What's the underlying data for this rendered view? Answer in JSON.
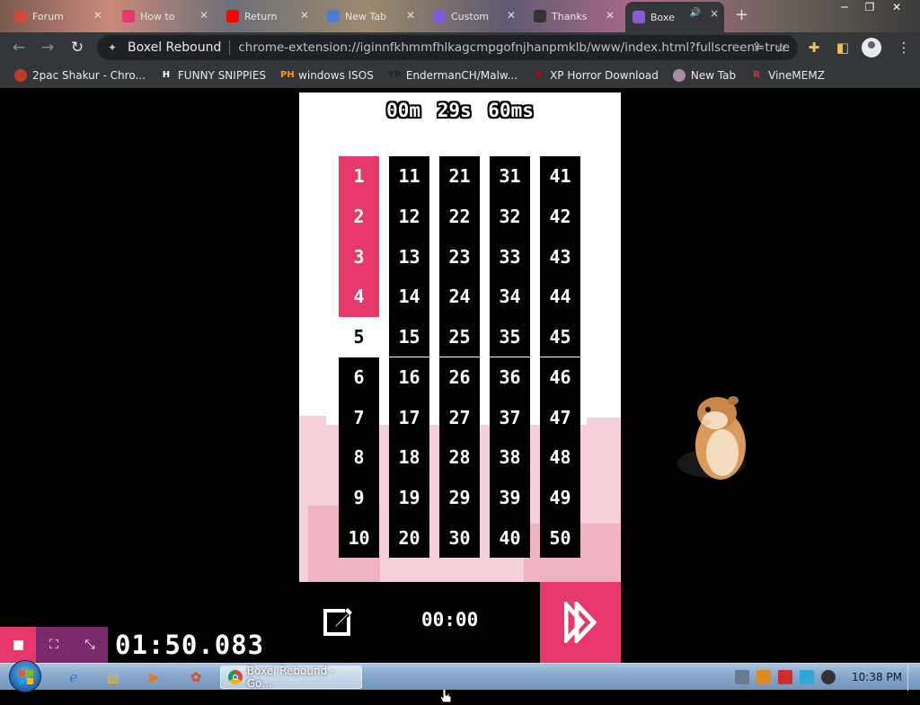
{
  "tabs": [
    {
      "title": "Forum",
      "color": "#d04a3a"
    },
    {
      "title": "How to",
      "color": "#e6386a"
    },
    {
      "title": "Return",
      "color": "#ff0000"
    },
    {
      "title": "New Tab",
      "color": "#4f7bd6"
    },
    {
      "title": "Custom",
      "color": "#7b5bd6"
    },
    {
      "title": "Thanks",
      "color": "#333333"
    },
    {
      "title": "Boxe",
      "color": "#8a5bd6",
      "active": true
    }
  ],
  "toolbar": {
    "site_name": "Boxel Rebound",
    "url": "chrome-extension://iginnfkhmmfhlkagcmpgofnjhanpmklb/www/index.html?fullscreen=true"
  },
  "bookmarks": [
    {
      "label": "2pac Shakur - Chro...",
      "icon_text": "",
      "icon_color": "#c0392b"
    },
    {
      "label": "FUNNY SNIPPIES",
      "icon_text": "H",
      "icon_color": "#ffffff"
    },
    {
      "label": "windows ISOS",
      "icon_text": "PH",
      "icon_color": "#ff9900"
    },
    {
      "label": "EndermanCH/Malw...",
      "icon_text": "YP",
      "icon_color": "#222222"
    },
    {
      "label": "XP Horror Download",
      "icon_text": "X",
      "icon_color": "#cc0000"
    },
    {
      "label": "New Tab",
      "icon_text": "",
      "icon_color": "#aa88aa"
    },
    {
      "label": "VineMEMZ",
      "icon_text": "R",
      "icon_color": "#d62d3a"
    }
  ],
  "game": {
    "timer": {
      "minutes": "00m",
      "seconds": "29s",
      "ms": "60ms"
    },
    "levels_completed": 4,
    "current_level": 5,
    "columns": [
      [
        "1",
        "2",
        "3",
        "4",
        "5",
        "6",
        "7",
        "8",
        "9",
        "10"
      ],
      [
        "11",
        "12",
        "13",
        "14",
        "15",
        "16",
        "17",
        "18",
        "19",
        "20"
      ],
      [
        "21",
        "22",
        "23",
        "24",
        "25",
        "26",
        "27",
        "28",
        "29",
        "30"
      ],
      [
        "31",
        "32",
        "33",
        "34",
        "35",
        "36",
        "37",
        "38",
        "39",
        "40"
      ],
      [
        "41",
        "42",
        "43",
        "44",
        "45",
        "46",
        "47",
        "48",
        "49",
        "50"
      ]
    ],
    "bottom_time": "00:00",
    "accent": "#e6386a"
  },
  "speedrun": {
    "time": "01:50.083"
  },
  "taskbar": {
    "active_task": "Boxel Rebound - Go...",
    "clock": "10:38 PM"
  }
}
